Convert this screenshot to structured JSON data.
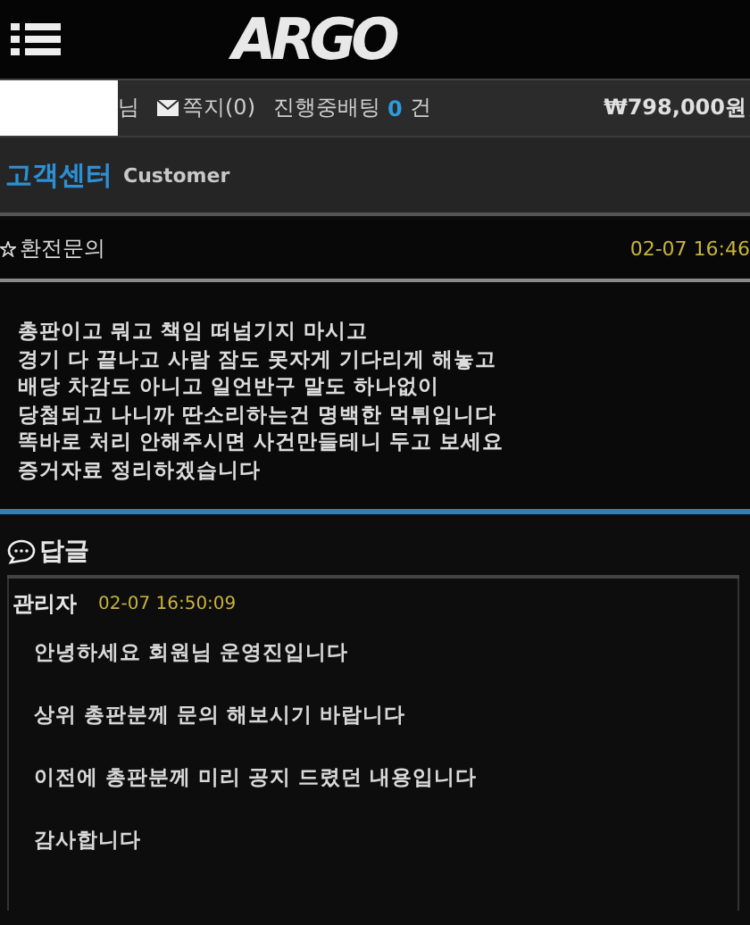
{
  "header": {
    "logo": "ARGO"
  },
  "user_bar": {
    "name_suffix": "님",
    "messages": "쪽지(0)",
    "betting_label": "진행중배팅",
    "betting_count": "0",
    "betting_unit": "건",
    "balance": "₩798,000원"
  },
  "section": {
    "title": "고객센터",
    "subtitle": "Customer"
  },
  "post": {
    "title": "환전문의",
    "date": "02-07 16:46",
    "lines": [
      "총판이고 뭐고 책임 떠넘기지 마시고",
      "경기 다 끝나고 사람 잠도 못자게 기다리게 해놓고",
      "배당 차감도 아니고 일언반구 말도 하나없이",
      "당첨되고 나니까 딴소리하는건 명백한 먹튀입니다",
      "똑바로 처리 안해주시면 사건만들테니 두고 보세요",
      "증거자료 정리하겠습니다"
    ]
  },
  "reply": {
    "heading": "답글",
    "author": "관리자",
    "date": "02-07 16:50:09",
    "paragraphs": [
      "안녕하세요 회원님 운영진입니다",
      "상위 총판분께 문의 해보시기 바랍니다",
      "이전에 총판분께 미리 공지 드렸던 내용입니다",
      "감사합니다"
    ]
  }
}
